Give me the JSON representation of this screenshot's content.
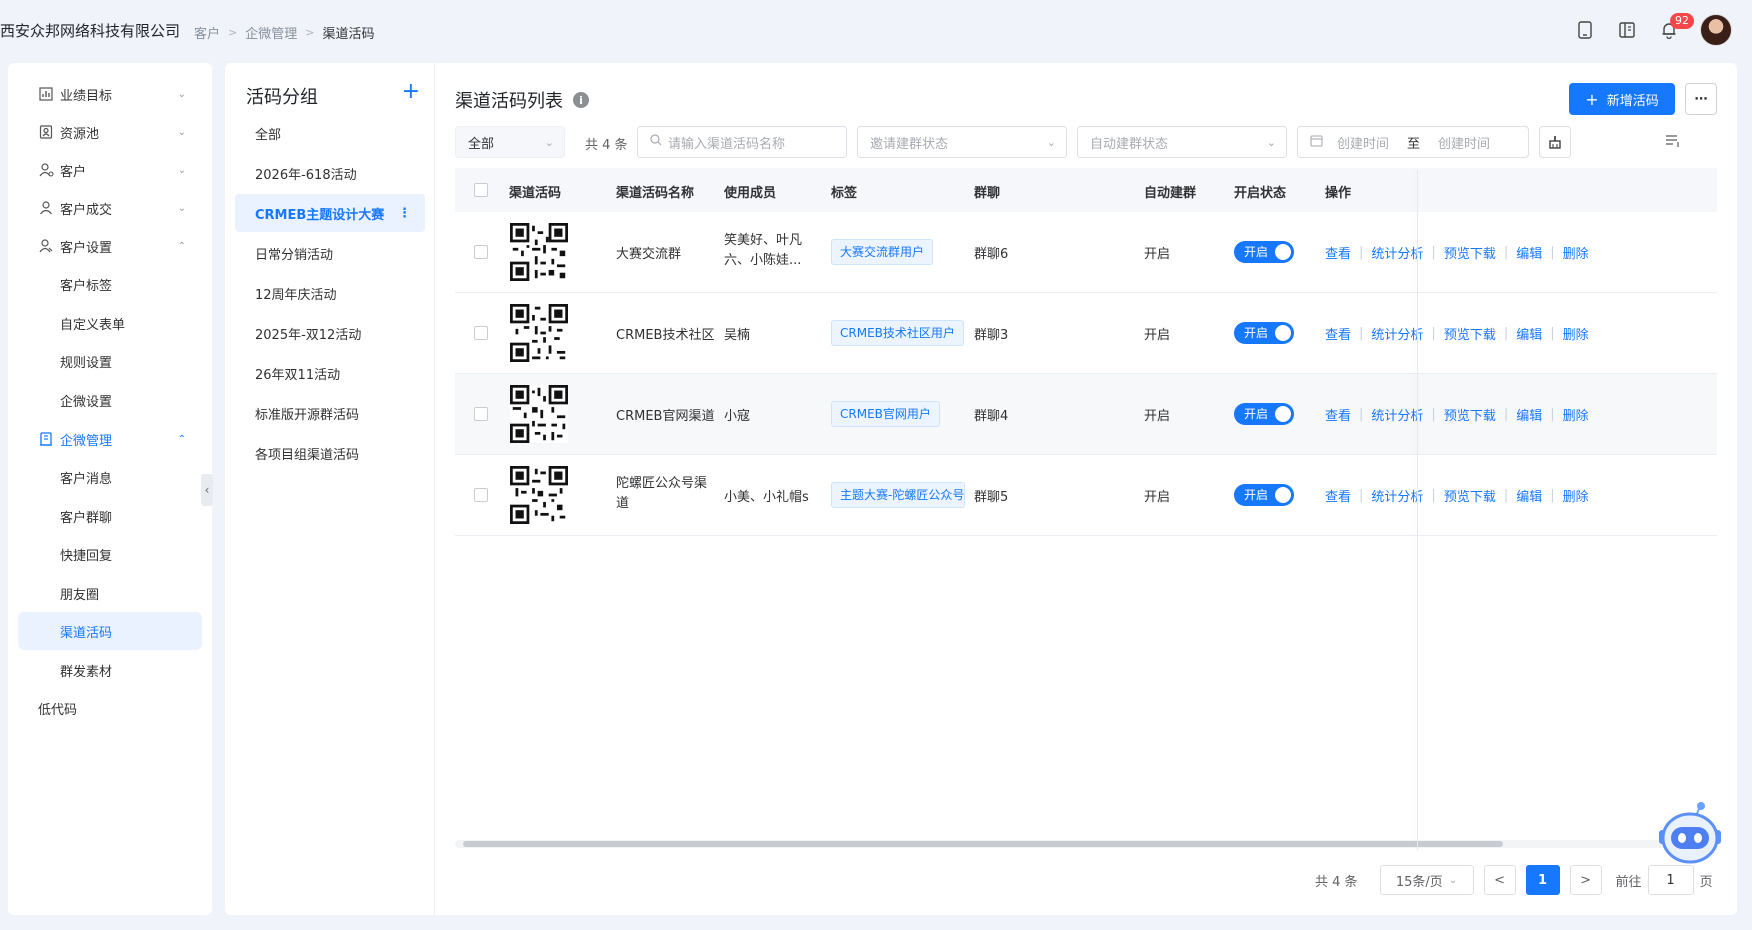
{
  "header": {
    "company": "西安众邦网络科技有限公司",
    "breadcrumb": [
      "客户",
      "企微管理",
      "渠道活码"
    ],
    "notifications_count": "92"
  },
  "sidebar": {
    "items": [
      {
        "label": "业绩目标",
        "icon": "chart-icon",
        "expanded": false
      },
      {
        "label": "资源池",
        "icon": "contact-card-icon",
        "expanded": false
      },
      {
        "label": "客户",
        "icon": "user-search-icon",
        "expanded": false
      },
      {
        "label": "客户成交",
        "icon": "user-icon",
        "expanded": false
      },
      {
        "label": "客户设置",
        "icon": "user-settings-icon",
        "expanded": true
      }
    ],
    "customer_settings_children": [
      "客户标签",
      "自定义表单",
      "规则设置",
      "企微设置"
    ],
    "wecom_label": "企微管理",
    "wecom_children": [
      "客户消息",
      "客户群聊",
      "快捷回复",
      "朋友圈",
      "渠道活码",
      "群发素材"
    ],
    "lowcode_label": "低代码"
  },
  "groups": {
    "title": "活码分组",
    "items": [
      "全部",
      "2026年-618活动",
      "CRMEB主题设计大赛",
      "日常分销活动",
      "12周年庆活动",
      "2025年-双12活动",
      "26年双11活动",
      "标准版开源群活码",
      "各项目组渠道活码"
    ],
    "active_index": 2
  },
  "main": {
    "title": "渠道活码列表",
    "add_button": "新增活码",
    "filters": {
      "scope": "全部",
      "total_text": "共 4 条",
      "search_placeholder": "请输入渠道活码名称",
      "invite_status_placeholder": "邀请建群状态",
      "auto_status_placeholder": "自动建群状态",
      "date_start_placeholder": "创建时间",
      "date_separator": "至",
      "date_end_placeholder": "创建时间"
    },
    "columns": [
      "渠道活码",
      "渠道活码名称",
      "使用成员",
      "标签",
      "群聊",
      "自动建群",
      "开启状态",
      "操作"
    ],
    "rows": [
      {
        "name": "大赛交流群",
        "members": "笑美好、叶凡六、小陈娃...",
        "tag": "大赛交流群用户",
        "group": "群聊6",
        "auto": "开启",
        "status": "开启"
      },
      {
        "name": "CRMEB技术社区",
        "members": "吴楠",
        "tag": "CRMEB技术社区用户",
        "group": "群聊3",
        "auto": "开启",
        "status": "开启"
      },
      {
        "name": "CRMEB官网渠道",
        "members": "小寇",
        "tag": "CRMEB官网用户",
        "group": "群聊4",
        "auto": "开启",
        "status": "开启"
      },
      {
        "name": "陀螺匠公众号渠道",
        "members": "小美、小礼帽s",
        "tag": "主题大赛-陀螺匠公众号用户",
        "group": "群聊5",
        "auto": "开启",
        "status": "开启"
      }
    ],
    "actions": [
      "查看",
      "统计分析",
      "预览下载",
      "编辑",
      "删除"
    ]
  },
  "pagination": {
    "total": "共 4 条",
    "page_size": "15条/页",
    "prev": "<",
    "current": "1",
    "next": ">",
    "goto_label": "前往",
    "goto_value": "1",
    "page_suffix": "页"
  },
  "colors": {
    "accent": "#1677ff",
    "badge": "#f5464a"
  }
}
